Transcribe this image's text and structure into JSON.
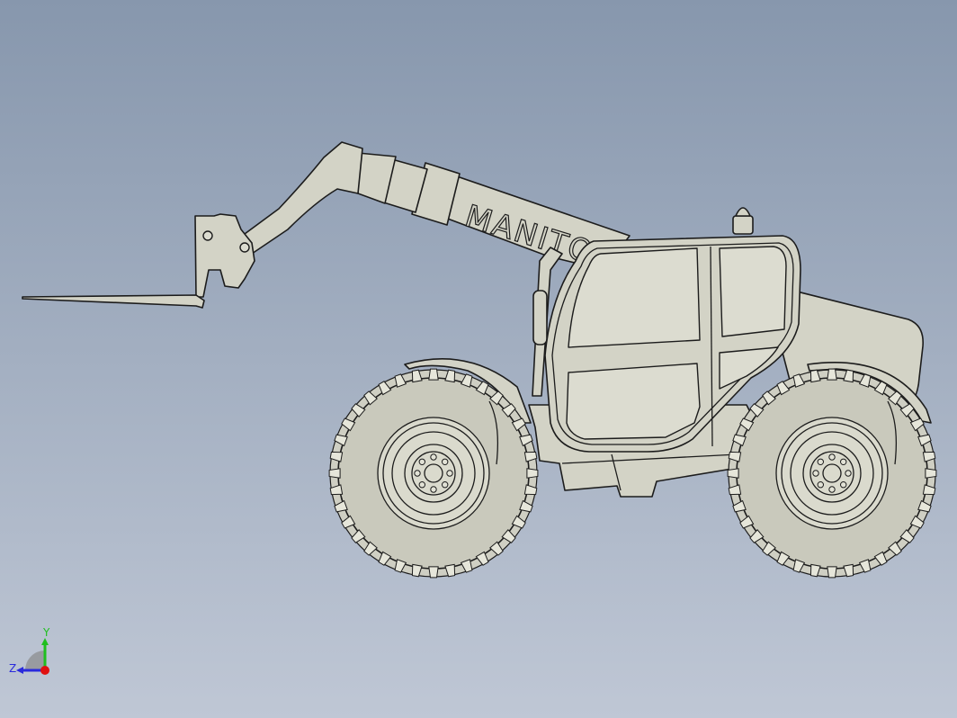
{
  "model": {
    "boom_text": "MANITOU"
  },
  "triad": {
    "y_label": "Y",
    "z_label": "Z",
    "y_color": "#1fbf1f",
    "z_color": "#2a2adc",
    "x_color": "#e01010"
  },
  "colors": {
    "background_top": "#8797ad",
    "background_bottom": "#bfc7d5",
    "part_fill": "#d3d3c6"
  }
}
